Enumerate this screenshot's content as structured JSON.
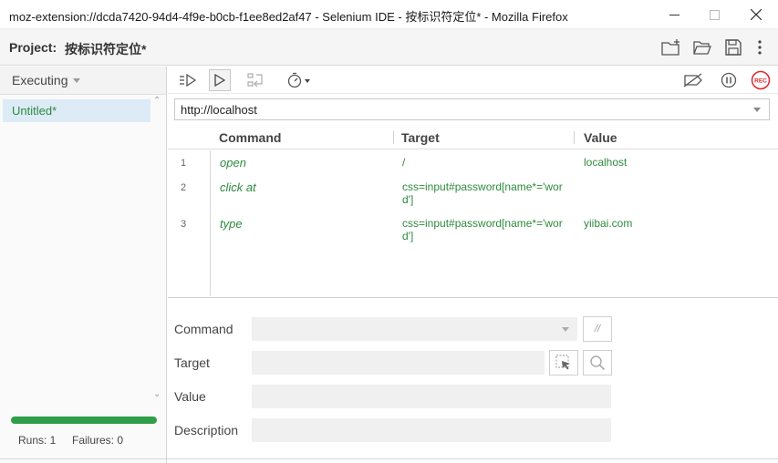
{
  "window": {
    "title": "moz-extension://dcda7420-94d4-4f9e-b0cb-f1ee8ed2af47 - Selenium IDE - 按标识符定位* - Mozilla Firefox",
    "controls": [
      "minimize-icon",
      "maximize-icon",
      "close-icon"
    ]
  },
  "project": {
    "label": "Project:",
    "name": "按标识符定位*",
    "icons": [
      "new-suite-icon",
      "open-folder-icon",
      "save-icon",
      "more-vert-icon"
    ]
  },
  "sidebar": {
    "mode_label": "Executing",
    "tests": [
      {
        "label": "Untitled*",
        "selected": true
      }
    ],
    "progress": 1.0,
    "runs_label": "Runs: 1",
    "failures_label": "Failures: 0",
    "progress_color": "#2e9e48"
  },
  "toolbar": {
    "left_icons": [
      "run-all-icon",
      "run-current-icon",
      "step-over-icon",
      "speed-timer-icon"
    ],
    "right_icons": [
      "disable-breakpoints-icon",
      "pause-icon",
      "record-icon"
    ],
    "record_label": "REC",
    "record_color": "#e0252c"
  },
  "url": {
    "value": "http://localhost"
  },
  "table": {
    "headers": [
      "Command",
      "Target",
      "Value"
    ],
    "rows": [
      {
        "num": "1",
        "command": "open",
        "target": "/",
        "value": "localhost"
      },
      {
        "num": "2",
        "command": "click at",
        "target": "css=input#password[name*='word']",
        "value": ""
      },
      {
        "num": "3",
        "command": "type",
        "target": "css=input#password[name*='word']",
        "value": "yiibai.com"
      }
    ],
    "text_color": "#2e8a3e"
  },
  "editor": {
    "command_label": "Command",
    "target_label": "Target",
    "value_label": "Value",
    "description_label": "Description",
    "command_value": "",
    "target_value": "",
    "value_value": "",
    "description_value": "",
    "comment_button_label": "//"
  }
}
